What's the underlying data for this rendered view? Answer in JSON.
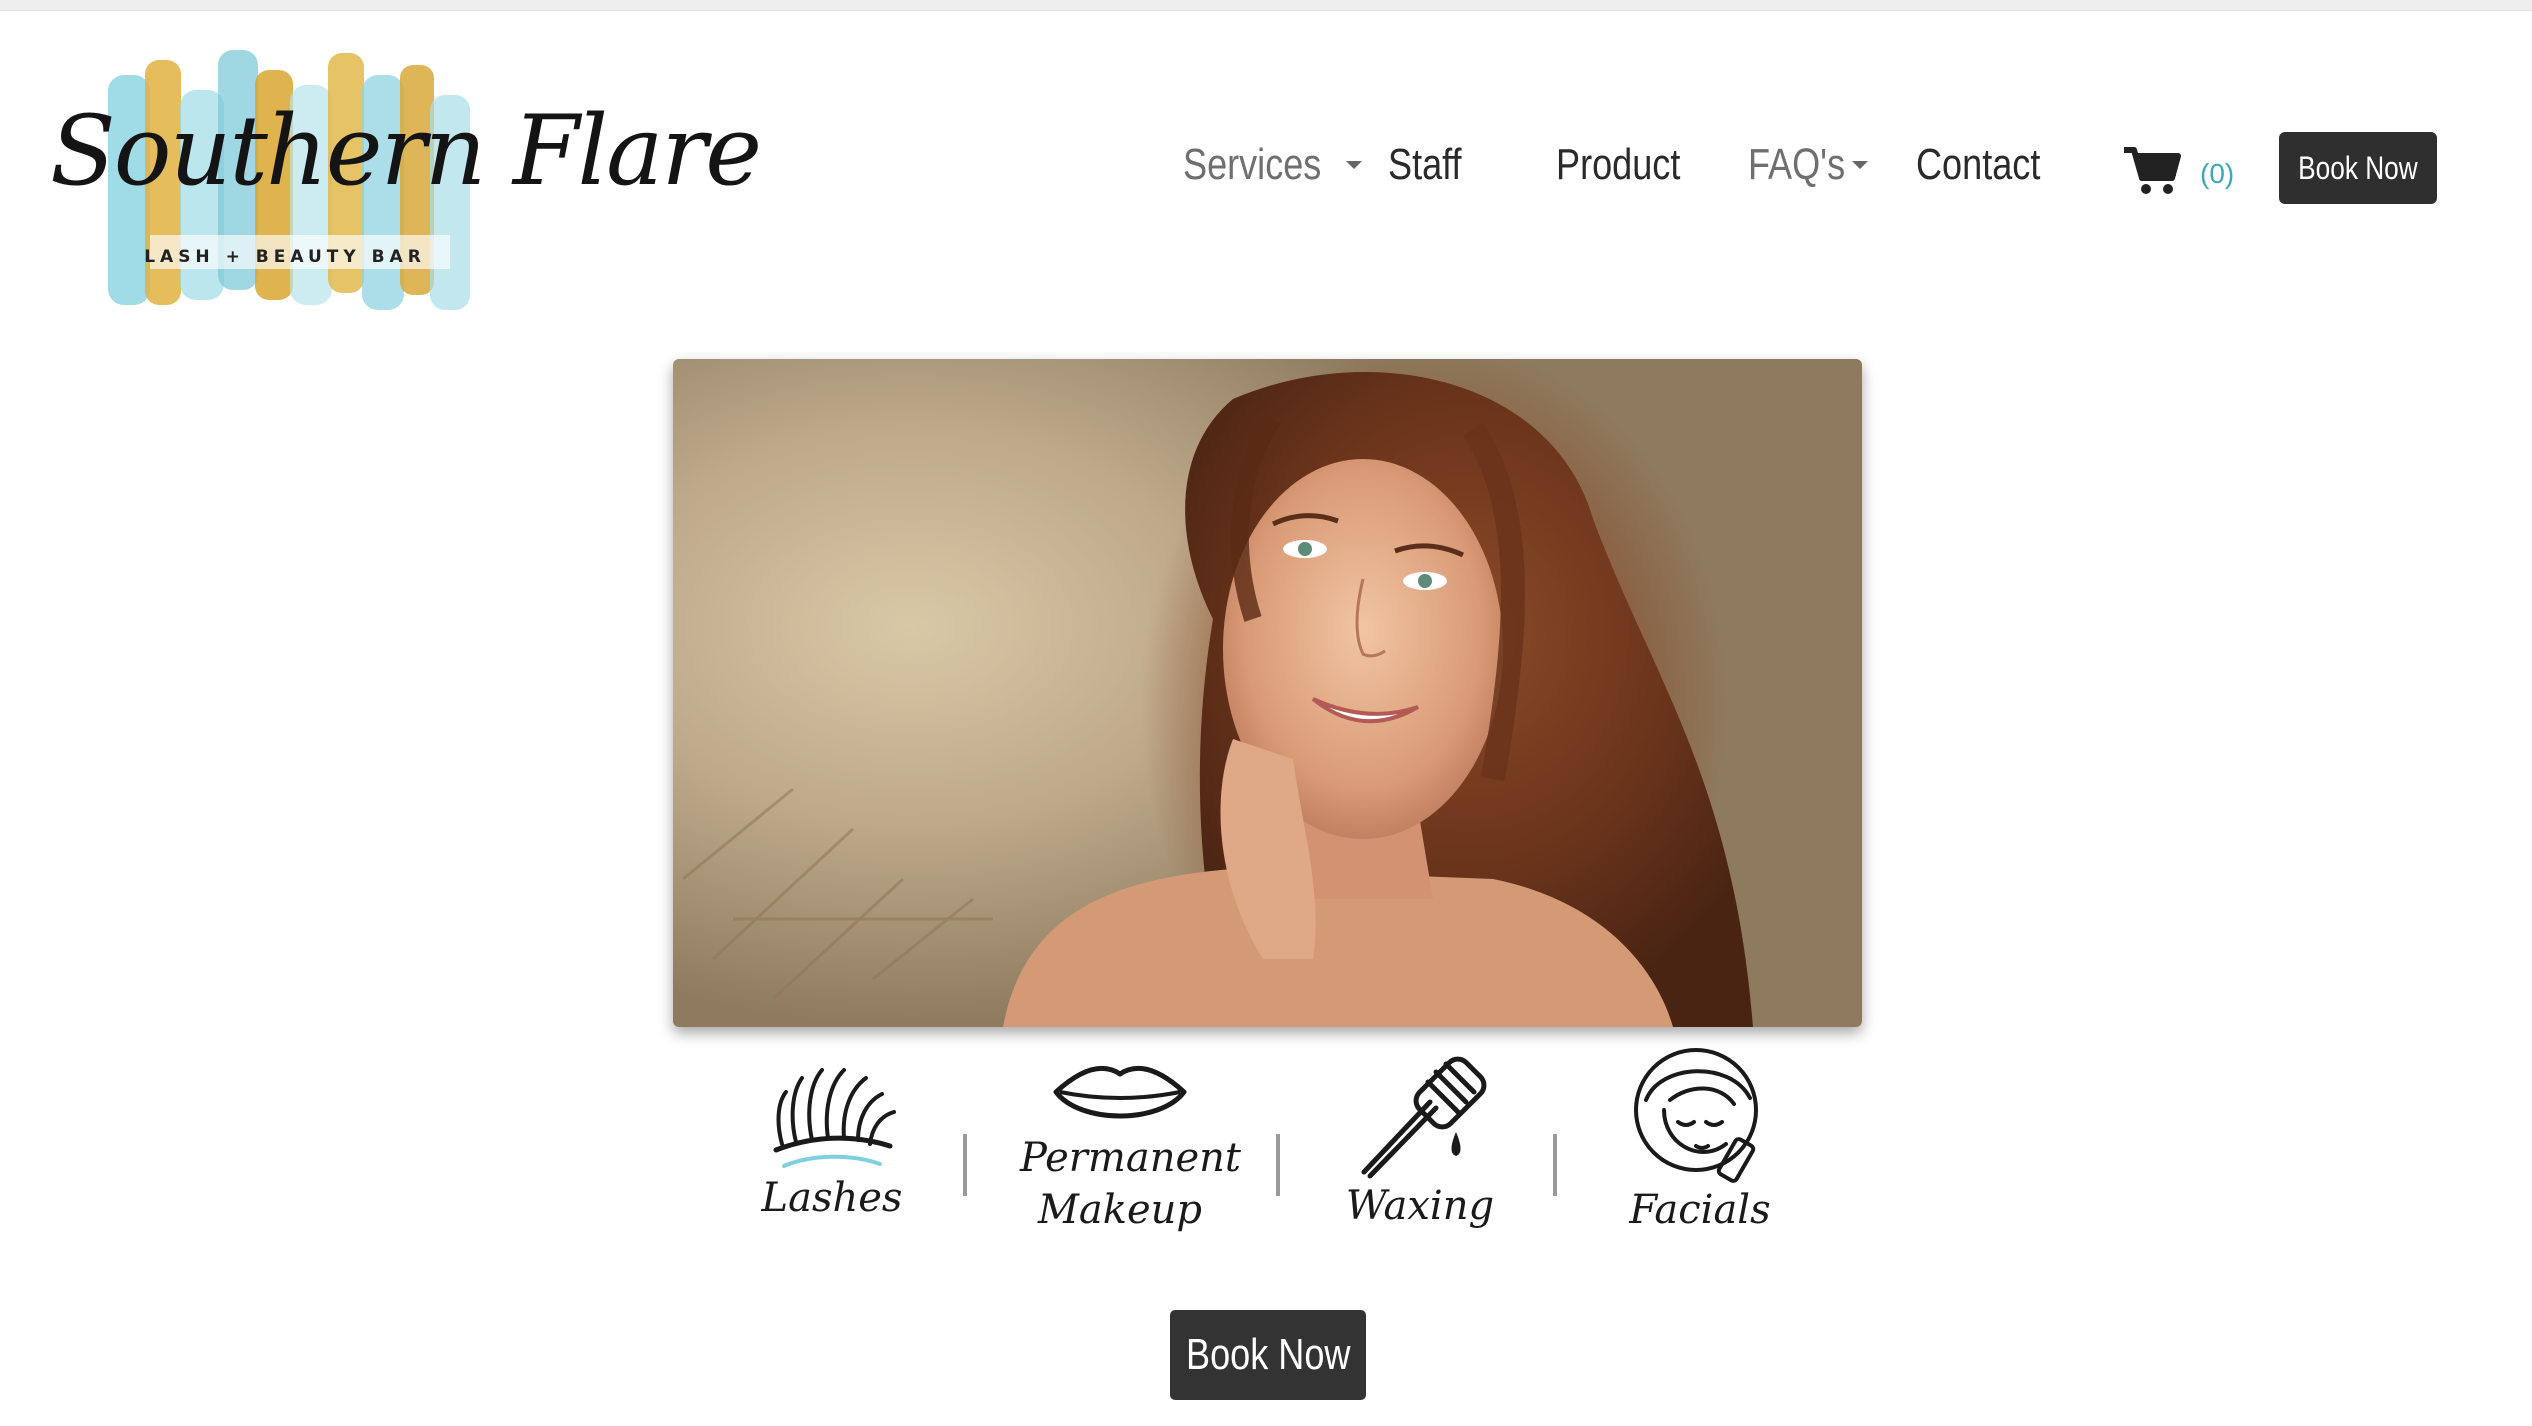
{
  "brand": {
    "name": "Southern Flare",
    "tagline": "LASH + BEAUTY BAR",
    "colors": {
      "gold": "#d9a62e",
      "teal": "#7fd0df",
      "ink": "#141414"
    }
  },
  "nav": {
    "items": [
      {
        "label": "Services",
        "has_dropdown": true
      },
      {
        "label": "Staff",
        "has_dropdown": false
      },
      {
        "label": "Product",
        "has_dropdown": false
      },
      {
        "label": "FAQ's",
        "has_dropdown": true
      },
      {
        "label": "Contact",
        "has_dropdown": false
      }
    ],
    "cart_icon": "shopping-cart-icon",
    "cart_count": "(0)",
    "book_label": "Book Now"
  },
  "hero": {
    "image_icon": "hero-photo"
  },
  "services": [
    {
      "label": "Lashes",
      "icon": "eyelash-icon"
    },
    {
      "label": "Permanent\nMakeup",
      "icon": "lips-icon"
    },
    {
      "label": "Waxing",
      "icon": "honey-dipper-icon"
    },
    {
      "label": "Facials",
      "icon": "face-towel-icon"
    }
  ],
  "cta": {
    "book_label": "Book Now"
  },
  "accent": {
    "teal_link": "#3fa7b6",
    "button_bg": "#333333"
  }
}
